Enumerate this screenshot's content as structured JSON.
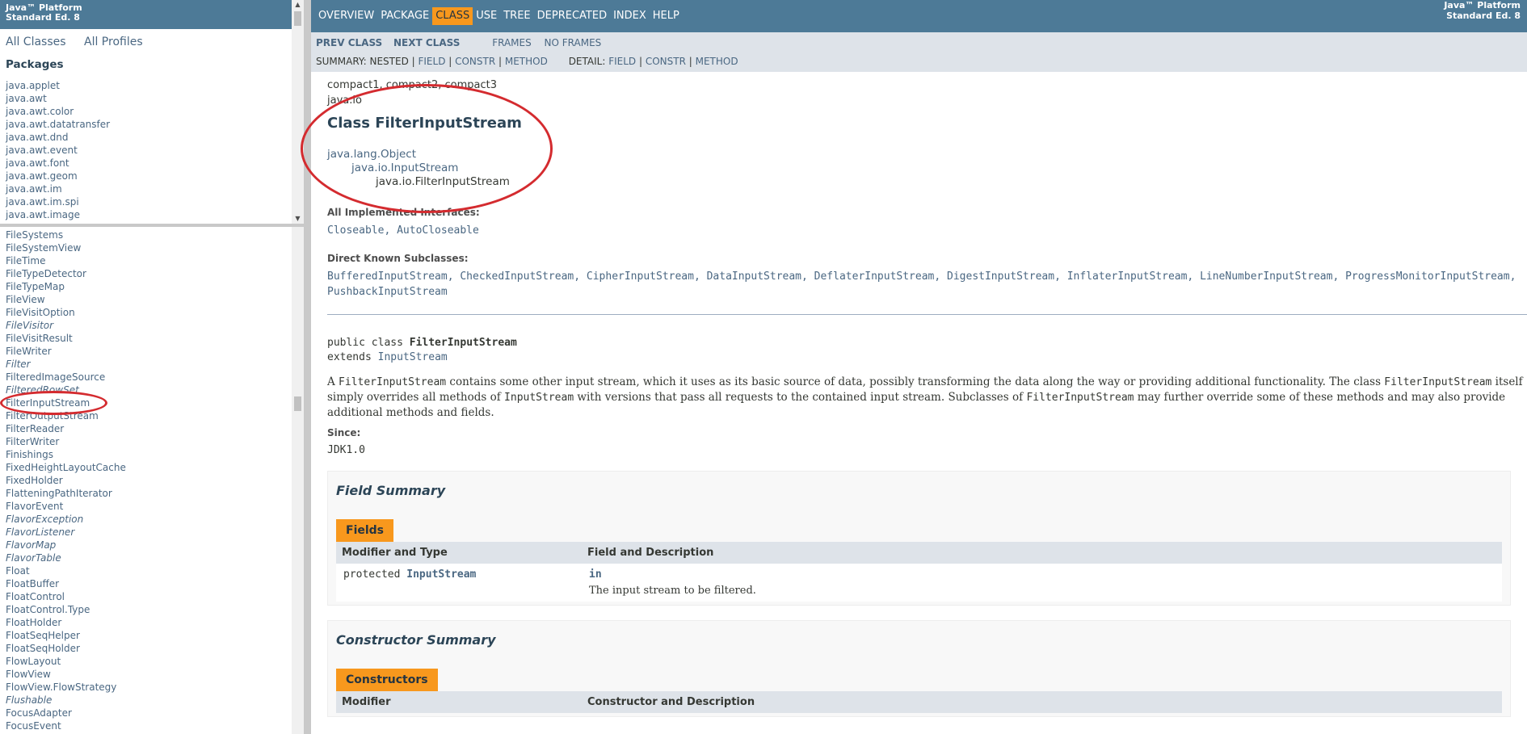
{
  "left_top": {
    "banner_line1": "Java™ Platform",
    "banner_line2": "Standard Ed. 8",
    "all_classes": "All Classes",
    "all_profiles": "All Profiles",
    "packages_title": "Packages",
    "packages": [
      "java.applet",
      "java.awt",
      "java.awt.color",
      "java.awt.datatransfer",
      "java.awt.dnd",
      "java.awt.event",
      "java.awt.font",
      "java.awt.geom",
      "java.awt.im",
      "java.awt.im.spi",
      "java.awt.image"
    ]
  },
  "left_bottom": {
    "classes": [
      {
        "name": "FileSystems",
        "italic": false
      },
      {
        "name": "FileSystemView",
        "italic": false
      },
      {
        "name": "FileTime",
        "italic": false
      },
      {
        "name": "FileTypeDetector",
        "italic": false
      },
      {
        "name": "FileTypeMap",
        "italic": false
      },
      {
        "name": "FileView",
        "italic": false
      },
      {
        "name": "FileVisitOption",
        "italic": false
      },
      {
        "name": "FileVisitor",
        "italic": true
      },
      {
        "name": "FileVisitResult",
        "italic": false
      },
      {
        "name": "FileWriter",
        "italic": false
      },
      {
        "name": "Filter",
        "italic": true
      },
      {
        "name": "FilteredImageSource",
        "italic": false
      },
      {
        "name": "FilteredRowSet",
        "italic": true
      },
      {
        "name": "FilterInputStream",
        "italic": false
      },
      {
        "name": "FilterOutputStream",
        "italic": false
      },
      {
        "name": "FilterReader",
        "italic": false
      },
      {
        "name": "FilterWriter",
        "italic": false
      },
      {
        "name": "Finishings",
        "italic": false
      },
      {
        "name": "FixedHeightLayoutCache",
        "italic": false
      },
      {
        "name": "FixedHolder",
        "italic": false
      },
      {
        "name": "FlatteningPathIterator",
        "italic": false
      },
      {
        "name": "FlavorEvent",
        "italic": false
      },
      {
        "name": "FlavorException",
        "italic": true
      },
      {
        "name": "FlavorListener",
        "italic": true
      },
      {
        "name": "FlavorMap",
        "italic": true
      },
      {
        "name": "FlavorTable",
        "italic": true
      },
      {
        "name": "Float",
        "italic": false
      },
      {
        "name": "FloatBuffer",
        "italic": false
      },
      {
        "name": "FloatControl",
        "italic": false
      },
      {
        "name": "FloatControl.Type",
        "italic": false
      },
      {
        "name": "FloatHolder",
        "italic": false
      },
      {
        "name": "FloatSeqHelper",
        "italic": false
      },
      {
        "name": "FloatSeqHolder",
        "italic": false
      },
      {
        "name": "FlowLayout",
        "italic": false
      },
      {
        "name": "FlowView",
        "italic": false
      },
      {
        "name": "FlowView.FlowStrategy",
        "italic": false
      },
      {
        "name": "Flushable",
        "italic": true
      },
      {
        "name": "FocusAdapter",
        "italic": false
      },
      {
        "name": "FocusEvent",
        "italic": false
      }
    ]
  },
  "nav": {
    "items": [
      "OVERVIEW",
      "PACKAGE",
      "CLASS",
      "USE",
      "TREE",
      "DEPRECATED",
      "INDEX",
      "HELP"
    ],
    "active": "CLASS",
    "about_line1": "Java™ Platform",
    "about_line2": "Standard Ed. 8"
  },
  "subnav": {
    "prev_class": "PREV CLASS",
    "next_class": "NEXT CLASS",
    "frames": "FRAMES",
    "no_frames": "NO FRAMES",
    "summary_label": "SUMMARY: NESTED | ",
    "summary_field": "FIELD",
    "sep1": " | ",
    "summary_constr": "CONSTR",
    "sep2": " | ",
    "summary_method": "METHOD",
    "detail_label": "DETAIL: ",
    "detail_field": "FIELD",
    "sep3": " | ",
    "detail_constr": "CONSTR",
    "sep4": " | ",
    "detail_method": "METHOD"
  },
  "content": {
    "profiles": "compact1, compact2, compact3",
    "package": "java.io",
    "title": "Class FilterInputStream",
    "inheritance": [
      "java.lang.Object",
      "java.io.InputStream",
      "java.io.FilterInputStream"
    ],
    "interfaces_title": "All Implemented Interfaces:",
    "interfaces": "Closeable, AutoCloseable",
    "subclasses_title": "Direct Known Subclasses:",
    "subclasses": "BufferedInputStream, CheckedInputStream, CipherInputStream, DataInputStream, DeflaterInputStream, DigestInputStream, InflaterInputStream, LineNumberInputStream, ProgressMonitorInputStream, PushbackInputStream",
    "decl_prefix": "public class ",
    "decl_name": "FilterInputStream",
    "decl_extends": "extends ",
    "decl_super": "InputStream",
    "desc_p1": "A ",
    "desc_c1": "FilterInputStream",
    "desc_p2": " contains some other input stream, which it uses as its basic source of data, possibly transforming the data along the way or providing additional functionality. The class ",
    "desc_c2": "FilterInputStream",
    "desc_p3": " itself simply overrides all methods of ",
    "desc_c3": "InputStream",
    "desc_p4": " with versions that pass all requests to the contained input stream. Subclasses of ",
    "desc_c4": "FilterInputStream",
    "desc_p5": " may further override some of these methods and may also provide additional methods and fields.",
    "since_title": "Since:",
    "since_value": "JDK1.0"
  },
  "field_summary": {
    "title": "Field Summary",
    "caption": "Fields",
    "col1": "Modifier and Type",
    "col2": "Field and Description",
    "row_modifier": "protected ",
    "row_type": "InputStream",
    "row_field": "in",
    "row_desc": "The input stream to be filtered."
  },
  "constructor_summary": {
    "title": "Constructor Summary",
    "caption": "Constructors",
    "col1": "Modifier",
    "col2": "Constructor and Description"
  }
}
